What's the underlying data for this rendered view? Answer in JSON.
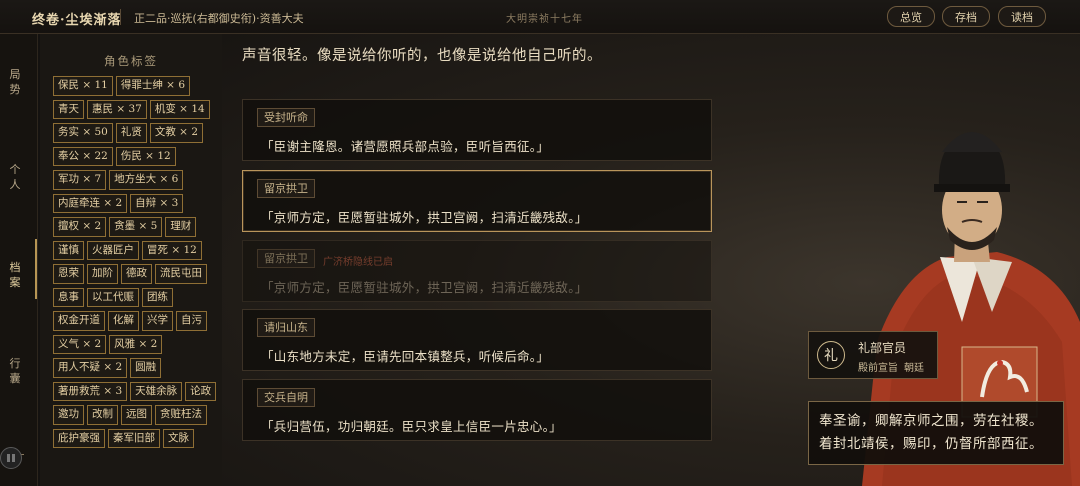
{
  "header": {
    "title": "终卷·尘埃渐落",
    "rank": "正二品·巡抚(右都御史衔)·资善大夫",
    "era": "大明崇祯十七年",
    "buttons": [
      "总览",
      "存档",
      "读档"
    ]
  },
  "nav": {
    "items": [
      "局势",
      "个人",
      "档案",
      "行囊"
    ],
    "active": "档案"
  },
  "tag_panel": {
    "title": "角色标签",
    "tags": [
      "保民 × 11",
      "得罪士绅 × 6",
      "青天",
      "惠民 × 37",
      "机变 × 14",
      "务实 × 50",
      "礼贤",
      "文教 × 2",
      "奉公 × 22",
      "伤民 × 12",
      "军功 × 7",
      "地方坐大 × 6",
      "内庭牵连 × 2",
      "自辩 × 3",
      "擅权 × 2",
      "贪墨 × 5",
      "理财",
      "谨慎",
      "火器匠户",
      "冒死 × 12",
      "恩荣",
      "加阶",
      "德政",
      "流民屯田",
      "息事",
      "以工代赈",
      "团练",
      "权金开道",
      "化解",
      "兴学",
      "自污",
      "义气 × 2",
      "风雅 × 2",
      "用人不疑 × 2",
      "圆融",
      "著册救荒 × 3",
      "天雄余脉",
      "论政",
      "邀功",
      "改制",
      "远图",
      "贪赃枉法",
      "庇护豪强",
      "秦军旧部",
      "文脉"
    ]
  },
  "story": {
    "narration": "声音很轻。像是说给你听的，也像是说给他自己听的。",
    "choices": [
      {
        "label": "受封听命",
        "note": "",
        "text": "「臣谢主隆恩。诸营愿照兵部点验，臣听旨西征。」",
        "state": "normal"
      },
      {
        "label": "留京拱卫",
        "note": "",
        "text": "「京师方定，臣愿暂驻城外，拱卫宫阙，扫清近畿残敌。」",
        "state": "selected"
      },
      {
        "label": "留京拱卫",
        "note": "广济桥隐线已启",
        "text": "「京师方定，臣愿暂驻城外，拱卫宫阙，扫清近畿残敌。」",
        "state": "disabled"
      },
      {
        "label": "请归山东",
        "note": "",
        "text": "「山东地方未定，臣请先回本镇整兵，听候后命。」",
        "state": "normal"
      },
      {
        "label": "交兵自明",
        "note": "",
        "text": "「兵归营伍，功归朝廷。臣只求皇上信臣一片忠心。」",
        "state": "normal"
      }
    ]
  },
  "npc": {
    "seal": "礼",
    "name": "礼部官员",
    "post": "殿前宣旨",
    "post2": "朝廷",
    "speech": "奉圣谕，卿解京师之围，劳在社稷。着封北靖侯，赐印，仍督所部西征。"
  },
  "colors": {
    "accent": "#b69554",
    "tag_border": "#8f6f35",
    "robe_red": "#a63a22",
    "warning": "#b9563c"
  }
}
